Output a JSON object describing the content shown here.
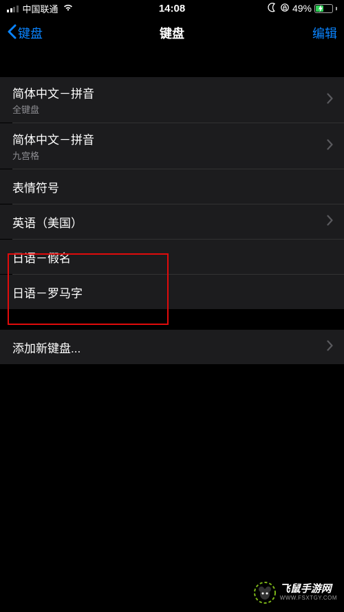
{
  "status": {
    "carrier": "中国联通",
    "time": "14:08",
    "battery_pct": "49%"
  },
  "nav": {
    "back_label": "键盘",
    "title": "键盘",
    "edit_label": "编辑"
  },
  "keyboards": [
    {
      "title": "简体中文－拼音",
      "subtitle": "全键盘",
      "chevron": true
    },
    {
      "title": "简体中文－拼音",
      "subtitle": "九宫格",
      "chevron": true
    },
    {
      "title": "表情符号",
      "subtitle": null,
      "chevron": false
    },
    {
      "title": "英语（美国）",
      "subtitle": null,
      "chevron": true
    },
    {
      "title": "日语－假名",
      "subtitle": null,
      "chevron": false
    },
    {
      "title": "日语－罗马字",
      "subtitle": null,
      "chevron": false
    }
  ],
  "add_keyboard": "添加新键盘...",
  "watermark": {
    "main": "飞鼠手游网",
    "sub": "WWW.FSXTGY.COM"
  }
}
